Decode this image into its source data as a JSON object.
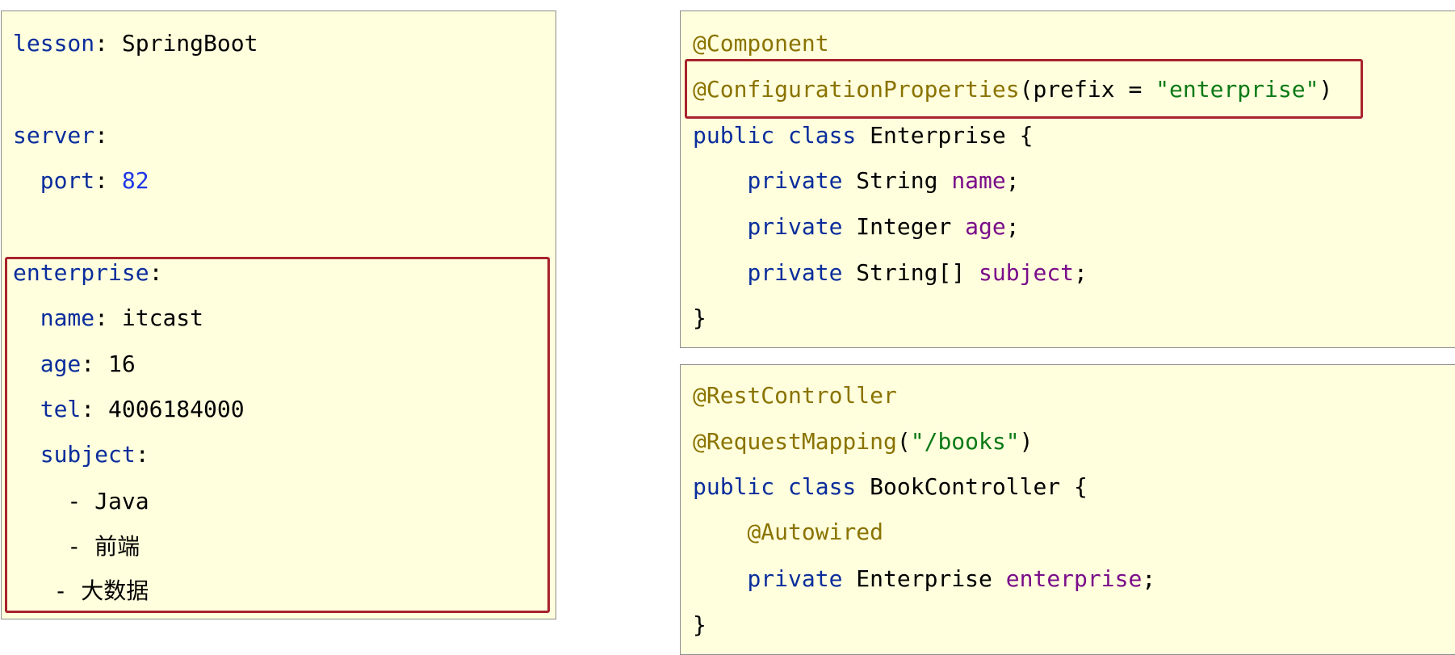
{
  "yaml": {
    "l1": {
      "key": "lesson",
      "sep": ": ",
      "value": "SpringBoot"
    },
    "l2": {
      "key": "server",
      "sep": ":"
    },
    "l3": {
      "indent": "  ",
      "key": "port",
      "sep": ": ",
      "value": "82"
    },
    "l4": {
      "key": "enterprise",
      "sep": ":"
    },
    "l5": {
      "indent": "  ",
      "key": "name",
      "sep": ": ",
      "value": "itcast"
    },
    "l6": {
      "indent": "  ",
      "key": "age",
      "sep": ": ",
      "value": "16"
    },
    "l7": {
      "indent": "  ",
      "key": "tel",
      "sep": ": ",
      "value": "4006184000"
    },
    "l8": {
      "indent": "  ",
      "key": "subject",
      "sep": ":"
    },
    "l9": {
      "prefix": "    - ",
      "value": "Java"
    },
    "l10": {
      "prefix": "    - ",
      "value": "前端"
    },
    "l11": {
      "prefix": "   - ",
      "value": "大数据"
    }
  },
  "enterprise_code": {
    "l1": {
      "annotation": "@Component"
    },
    "l2": {
      "annotation": "@ConfigurationProperties",
      "open": "(",
      "param": "prefix = ",
      "string": "\"enterprise\"",
      "close": ")"
    },
    "l3": {
      "kw": "public class",
      "sp": " ",
      "name": "Enterprise",
      "brace": " {"
    },
    "l4": {
      "indent": "    ",
      "kw": "private",
      "type": " String ",
      "field": "name",
      "end": ";"
    },
    "l5": {
      "indent": "    ",
      "kw": "private",
      "type": " Integer ",
      "field": "age",
      "end": ";"
    },
    "l6": {
      "indent": "    ",
      "kw": "private",
      "type": " String[] ",
      "field": "subject",
      "end": ";"
    },
    "l7": {
      "brace": "}"
    }
  },
  "controller_code": {
    "l1": {
      "annotation": "@RestController"
    },
    "l2": {
      "annotation": "@RequestMapping",
      "open": "(",
      "string": "\"/books\"",
      "close": ")"
    },
    "l3": {
      "kw": "public class",
      "sp": " ",
      "name": "BookController",
      "brace": " {"
    },
    "l4": {
      "indent": "    ",
      "annotation": "@Autowired"
    },
    "l5": {
      "indent": "    ",
      "kw": "private",
      "type": " Enterprise ",
      "field": "enterprise",
      "end": ";"
    },
    "l6": {
      "brace": "}"
    }
  }
}
